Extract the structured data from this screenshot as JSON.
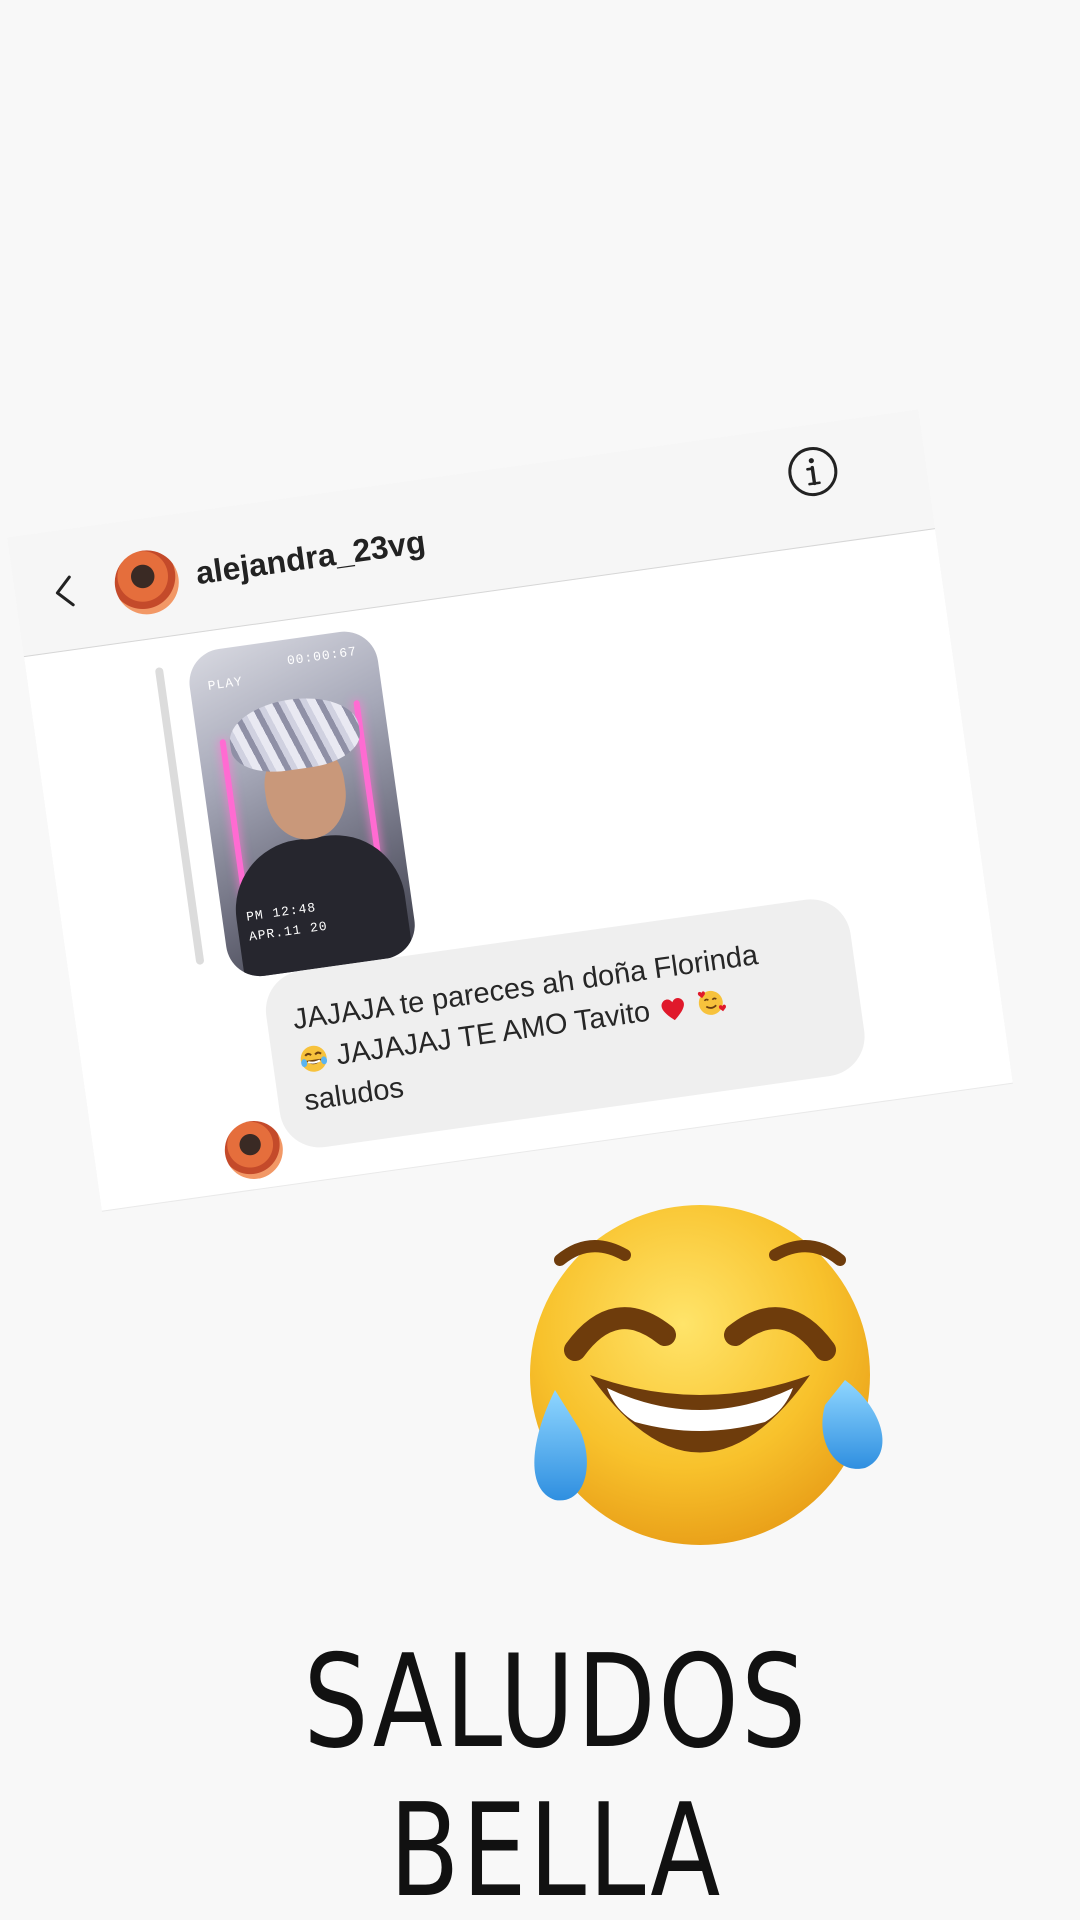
{
  "dm": {
    "username": "alejandra_23vg",
    "story_preview": {
      "top_left_label": "PLAY",
      "timecode": "00:00:67",
      "time_label": "PM 12:48",
      "date_label": "APR.11 20"
    },
    "message": {
      "line1": "JAJAJA te pareces ah doña Florinda",
      "line2": "JAJAJAJ TE AMO Tavito",
      "line3": "saludos"
    }
  },
  "caption": "SALUDOS BELLA",
  "icons": {
    "back": "chevron-left-icon",
    "info": "info-circle-icon",
    "heart": "red-heart-emoji",
    "hearts_face": "smiling-face-with-hearts-emoji",
    "laughing": "face-with-tears-of-joy-emoji"
  }
}
